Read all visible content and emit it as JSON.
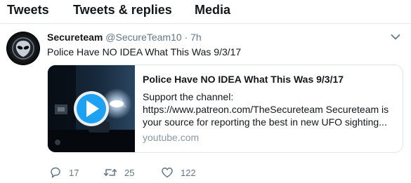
{
  "tabs": [
    "Tweets",
    "Tweets & replies",
    "Media"
  ],
  "tweet": {
    "display_name": "Secureteam",
    "handle": "@SecureTeam10",
    "separator": "·",
    "time": "7h",
    "text": "Police Have NO IDEA What This Was 9/3/17",
    "card": {
      "title": "Police Have NO IDEA What This Was 9/3/17",
      "desc_line1": "Support the channel:",
      "desc_line2": "https://www.patreon.com/TheSecureteam Secureteam is",
      "desc_line3": "your source for reporting the best in new UFO sighting...",
      "domain": "youtube.com"
    },
    "actions": {
      "replies": "17",
      "retweets": "25",
      "likes": "122"
    }
  },
  "colors": {
    "accent": "#1da1f2",
    "muted": "#657786",
    "border": "#e6ecf0"
  },
  "icons": [
    "alien-avatar",
    "chevron-down-icon",
    "play-icon",
    "reply-icon",
    "retweet-icon",
    "heart-icon"
  ]
}
